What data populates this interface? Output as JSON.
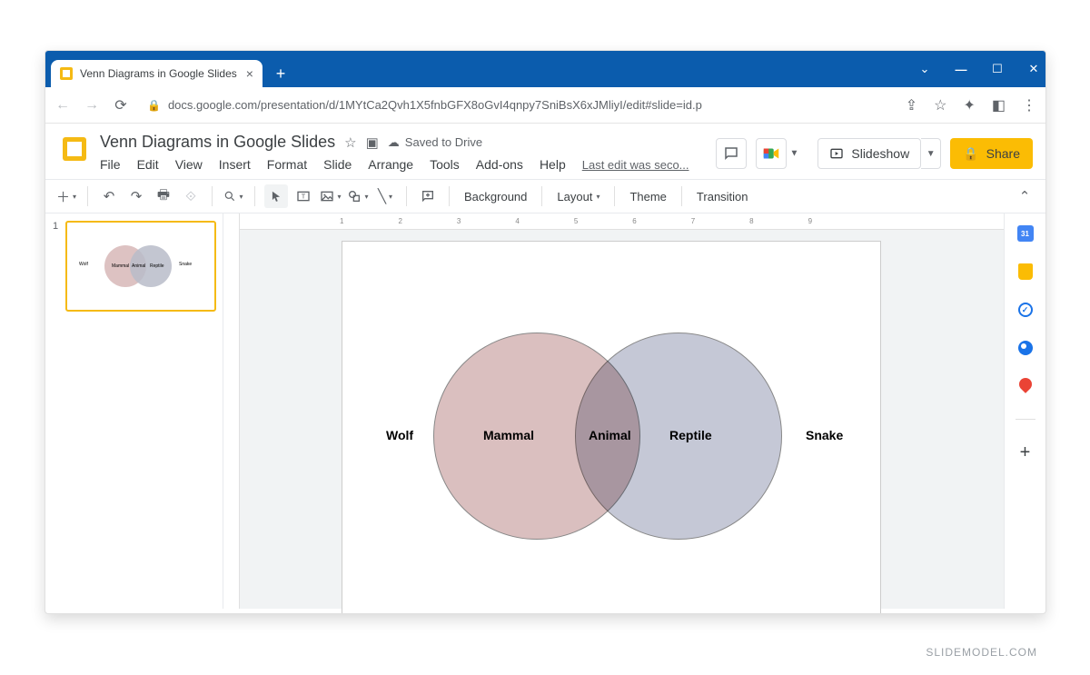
{
  "browser": {
    "tab_title": "Venn Diagrams in Google Slides",
    "url": "docs.google.com/presentation/d/1MYtCa2Qvh1X5fnbGFX8oGvI4qnpy7SniBsX6xJMliyI/edit#slide=id.p"
  },
  "header": {
    "doc_title": "Venn Diagrams in Google Slides",
    "save_status": "Saved to Drive",
    "last_edit": "Last edit was seco...",
    "menus": [
      "File",
      "Edit",
      "View",
      "Insert",
      "Format",
      "Slide",
      "Arrange",
      "Tools",
      "Add-ons",
      "Help"
    ],
    "slideshow_label": "Slideshow",
    "share_label": "Share"
  },
  "toolbar": {
    "background": "Background",
    "layout": "Layout",
    "theme": "Theme",
    "transition": "Transition"
  },
  "filmstrip": {
    "slides": [
      {
        "number": "1"
      }
    ]
  },
  "venn": {
    "left_outer": "Wolf",
    "left_inner": "Mammal",
    "center": "Animal",
    "right_inner": "Reptile",
    "right_outer": "Snake"
  },
  "ruler_marks": [
    "1",
    "2",
    "3",
    "4",
    "5",
    "6",
    "7",
    "8",
    "9"
  ],
  "watermark": "SLIDEMODEL.COM",
  "chart_data": {
    "type": "venn",
    "sets": [
      {
        "name": "Mammal",
        "outer_example": "Wolf",
        "color": "#d7b7b7"
      },
      {
        "name": "Reptile",
        "outer_example": "Snake",
        "color": "#b8bcc9"
      }
    ],
    "intersection_label": "Animal",
    "title": ""
  }
}
